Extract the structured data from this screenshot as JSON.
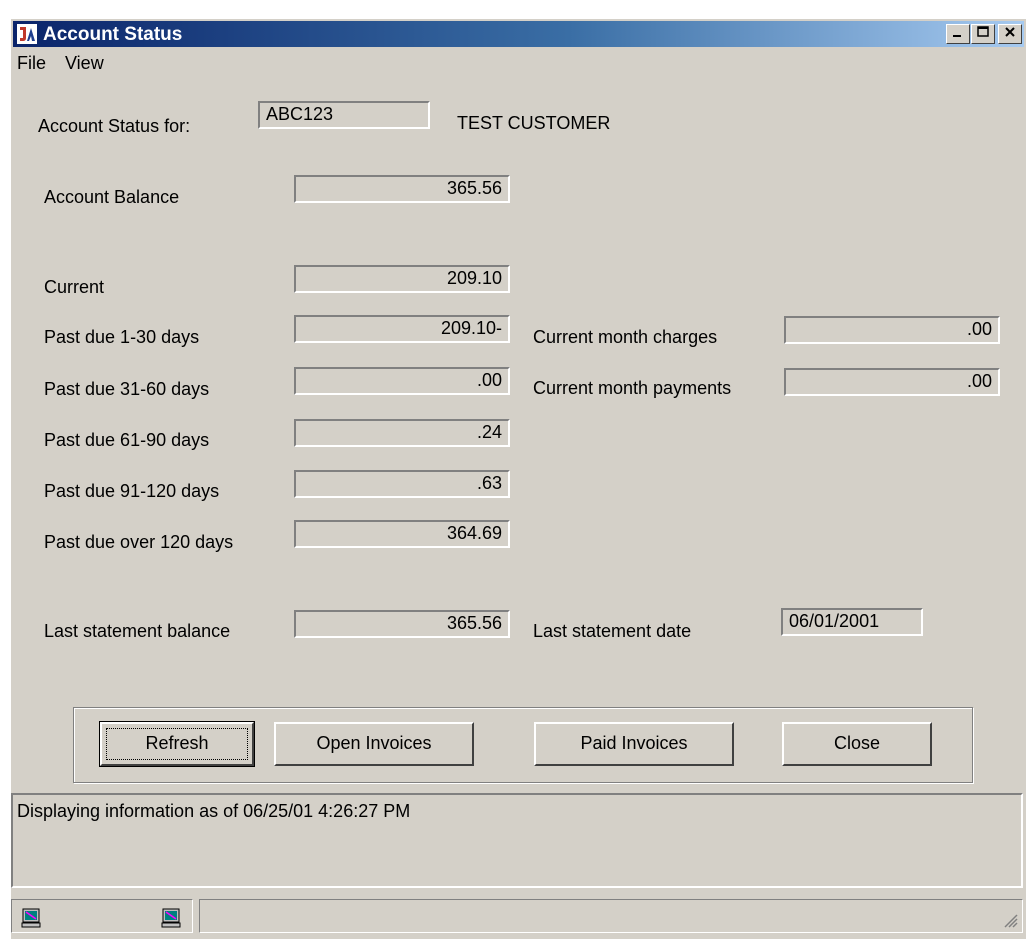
{
  "window": {
    "title": "Account Status"
  },
  "menu": {
    "file": "File",
    "view": "View"
  },
  "account": {
    "label": "Account Status for:",
    "id": "ABC123",
    "name": "TEST CUSTOMER"
  },
  "balance": {
    "label": "Account Balance",
    "value": "365.56"
  },
  "aging": [
    {
      "label": "Current",
      "value": "209.10"
    },
    {
      "label": "Past due 1-30 days",
      "value": "209.10-"
    },
    {
      "label": "Past due 31-60 days",
      "value": ".00"
    },
    {
      "label": "Past due 61-90 days",
      "value": ".24"
    },
    {
      "label": "Past due 91-120 days",
      "value": ".63"
    },
    {
      "label": "Past due over 120 days",
      "value": "364.69"
    }
  ],
  "month": {
    "charges_label": "Current month charges",
    "charges_value": ".00",
    "payments_label": "Current month payments",
    "payments_value": ".00"
  },
  "statement": {
    "balance_label": "Last statement balance",
    "balance_value": "365.56",
    "date_label": "Last statement date",
    "date_value": "06/01/2001"
  },
  "buttons": {
    "refresh": "Refresh",
    "open_invoices": "Open Invoices",
    "paid_invoices": "Paid Invoices",
    "close": "Close"
  },
  "status_message": "Displaying information as of 06/25/01   4:26:27 PM",
  "icons": {
    "app": "app-logo-icon",
    "status_left": "computer-icon",
    "status_right": "computer-icon"
  },
  "colors": {
    "title_start": "#0a246a",
    "title_end": "#a6caf0",
    "face": "#d4d0c8"
  }
}
